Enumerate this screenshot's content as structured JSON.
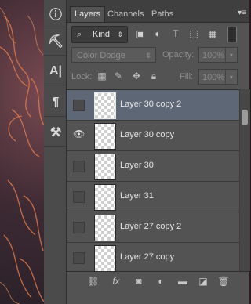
{
  "tabs": [
    {
      "label": "Layers",
      "active": true
    },
    {
      "label": "Channels",
      "active": false
    },
    {
      "label": "Paths",
      "active": false
    }
  ],
  "filter": {
    "kind_label": "Kind"
  },
  "blend": {
    "mode": "Color Dodge",
    "opacity_label": "Opacity:",
    "opacity_value": "100%"
  },
  "lock": {
    "label": "Lock:",
    "fill_label": "Fill:",
    "fill_value": "100%"
  },
  "layers": [
    {
      "name": "Layer 30 copy 2",
      "visible": false,
      "selected": true
    },
    {
      "name": "Layer 30 copy",
      "visible": true,
      "selected": false
    },
    {
      "name": "Layer 30",
      "visible": false,
      "selected": false
    },
    {
      "name": "Layer 31",
      "visible": false,
      "selected": false
    },
    {
      "name": "Layer 27 copy 2",
      "visible": false,
      "selected": false
    },
    {
      "name": "Layer 27 copy",
      "visible": false,
      "selected": false
    }
  ],
  "tools": [
    "info-icon",
    "brush-preset-icon",
    "character-icon",
    "paragraph-icon",
    "tool-presets-icon"
  ]
}
